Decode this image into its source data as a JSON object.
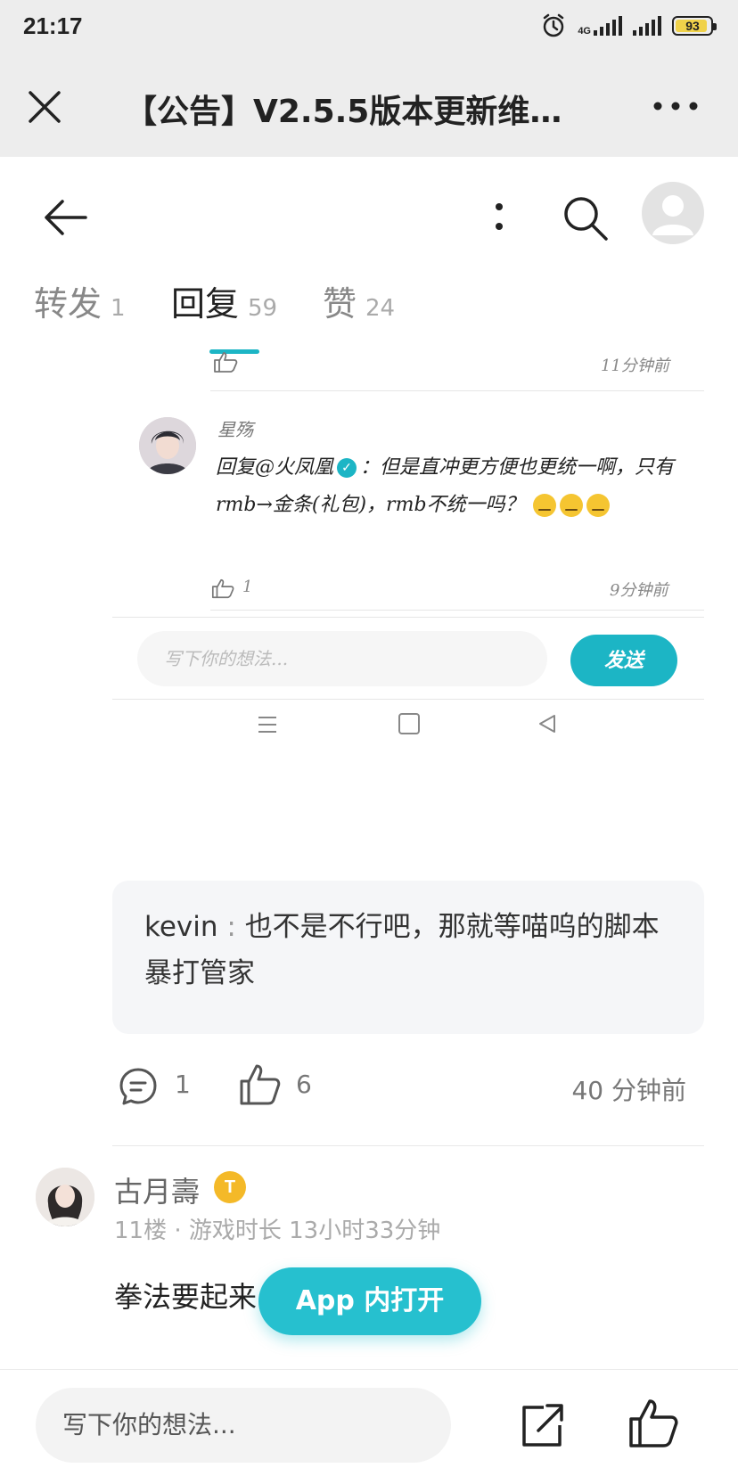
{
  "status_bar": {
    "time": "21:17",
    "network": "4G",
    "battery_level": "93",
    "battery_color": "#f0d24a"
  },
  "title_bar": {
    "title": "【公告】V2.5.5版本更新维…",
    "close_icon": "close-icon",
    "more_icon": "more-icon"
  },
  "header": {
    "back_icon": "arrow-left-icon",
    "kebab_icon": "kebab-icon",
    "search_icon": "search-icon",
    "avatar_icon": "user-avatar-icon"
  },
  "tabs": [
    {
      "label": "转发",
      "count": "1"
    },
    {
      "label": "回复",
      "count": "59"
    },
    {
      "label": "赞",
      "count": "24"
    }
  ],
  "accent_color": "#1cb5c5",
  "embedded_screenshot": {
    "top_time": "11分钟前",
    "reply": {
      "name": "星殇",
      "text_prefix": "回复@火凤凰",
      "text_body": "：但是直冲更方便也更统一啊，只有rmb→金条(礼包)，rmb不统一吗？",
      "likes": "1",
      "time": "9分钟前"
    },
    "input_placeholder": "写下你的想法...",
    "send_label": "发送"
  },
  "quote": {
    "name": "kevin",
    "separator": " : ",
    "text": "也不是不行吧，那就等喵呜的脚本暴打管家"
  },
  "actions": {
    "comment_count": "1",
    "like_count": "6",
    "time": "40 分钟前"
  },
  "comment2": {
    "name": "古月壽",
    "badge": "T",
    "meta": "11楼 · 游戏时长 13小时33分钟",
    "text": "拳法要起来"
  },
  "app_open_label": "App 内打开",
  "bottom": {
    "placeholder": "写下你的想法...",
    "share_icon": "share-icon",
    "like_icon": "thumb-up-icon"
  }
}
